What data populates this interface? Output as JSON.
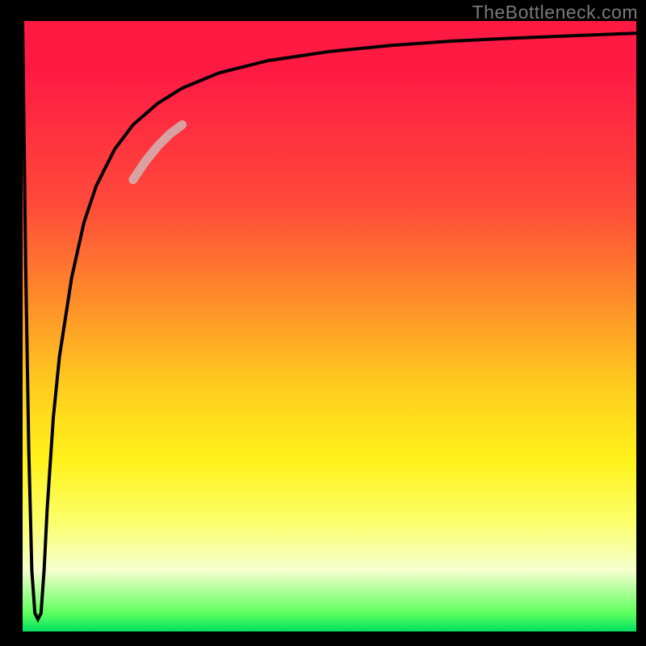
{
  "watermark": "TheBottleneck.com",
  "chart_data": {
    "type": "line",
    "title": "",
    "xlabel": "",
    "ylabel": "",
    "xlim": [
      0,
      100
    ],
    "ylim": [
      0,
      100
    ],
    "grid": false,
    "legend": false,
    "background_gradient": {
      "direction": "top-to-bottom",
      "stops": [
        {
          "pos": 0.0,
          "color": "#ff1a44"
        },
        {
          "pos": 0.3,
          "color": "#ff4a3a"
        },
        {
          "pos": 0.45,
          "color": "#ff8a2a"
        },
        {
          "pos": 0.6,
          "color": "#ffcd1e"
        },
        {
          "pos": 0.72,
          "color": "#fff21a"
        },
        {
          "pos": 0.82,
          "color": "#fbff6a"
        },
        {
          "pos": 0.9,
          "color": "#f6ffcf"
        },
        {
          "pos": 0.97,
          "color": "#5eff5e"
        },
        {
          "pos": 1.0,
          "color": "#00e060"
        }
      ]
    },
    "series": [
      {
        "name": "curve",
        "color": "#000000",
        "x": [
          0.0,
          0.5,
          1.0,
          1.5,
          2.0,
          2.5,
          3.0,
          3.5,
          4.0,
          5.0,
          6.0,
          8.0,
          10.0,
          12.0,
          15.0,
          18.0,
          22.0,
          26.0,
          32.0,
          40.0,
          50.0,
          60.0,
          70.0,
          80.0,
          90.0,
          100.0
        ],
        "y": [
          100,
          60,
          30,
          10,
          3,
          2,
          3,
          10,
          20,
          35,
          45,
          58,
          67,
          73,
          79,
          83,
          86.5,
          89,
          91.5,
          93.5,
          95,
          96,
          96.7,
          97.2,
          97.6,
          98
        ]
      },
      {
        "name": "highlight-segment",
        "color": "#d8a2a2",
        "thickness": 11,
        "x": [
          18.0,
          20.0,
          22.0,
          24.0,
          26.0
        ],
        "y": [
          74.0,
          77.0,
          79.5,
          81.5,
          83.0
        ]
      }
    ]
  }
}
